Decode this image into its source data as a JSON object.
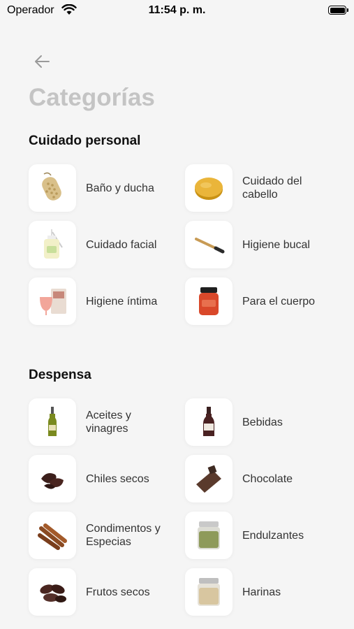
{
  "status_bar": {
    "carrier": "Operador",
    "time": "11:54 p. m."
  },
  "page": {
    "title": "Categorías"
  },
  "sections": [
    {
      "title": "Cuidado personal",
      "items": [
        {
          "label": "Baño y ducha",
          "icon": "loofah-icon"
        },
        {
          "label": "Cuidado del cabello",
          "icon": "shampoo-bar-icon"
        },
        {
          "label": "Cuidado facial",
          "icon": "serum-bottle-icon"
        },
        {
          "label": "Higiene bucal",
          "icon": "bamboo-toothbrush-icon"
        },
        {
          "label": "Higiene íntima",
          "icon": "menstrual-cup-icon"
        },
        {
          "label": "Para el cuerpo",
          "icon": "body-cream-jar-icon"
        }
      ]
    },
    {
      "title": "Despensa",
      "items": [
        {
          "label": "Aceites y vinagres",
          "icon": "oil-bottle-icon"
        },
        {
          "label": "Bebidas",
          "icon": "beverage-bottle-icon"
        },
        {
          "label": "Chiles secos",
          "icon": "dried-chili-icon"
        },
        {
          "label": "Chocolate",
          "icon": "chocolate-icon"
        },
        {
          "label": "Condimentos y Especias",
          "icon": "cinnamon-icon"
        },
        {
          "label": "Endulzantes",
          "icon": "sweetener-jar-icon"
        },
        {
          "label": "Frutos secos",
          "icon": "dates-icon"
        },
        {
          "label": "Harinas",
          "icon": "flour-jar-icon"
        }
      ]
    }
  ]
}
